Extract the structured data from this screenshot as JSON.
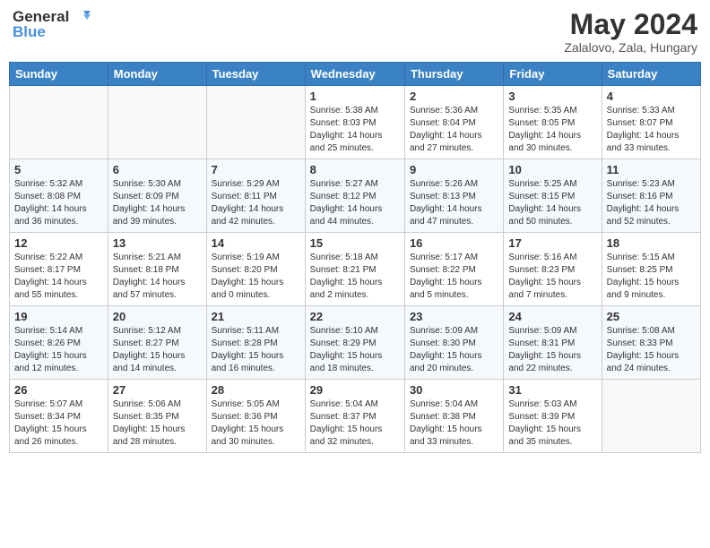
{
  "logo": {
    "text_general": "General",
    "text_blue": "Blue"
  },
  "title": {
    "month_year": "May 2024",
    "location": "Zalalovo, Zala, Hungary"
  },
  "days_of_week": [
    "Sunday",
    "Monday",
    "Tuesday",
    "Wednesday",
    "Thursday",
    "Friday",
    "Saturday"
  ],
  "weeks": [
    [
      {
        "day": "",
        "info": ""
      },
      {
        "day": "",
        "info": ""
      },
      {
        "day": "",
        "info": ""
      },
      {
        "day": "1",
        "info": "Sunrise: 5:38 AM\nSunset: 8:03 PM\nDaylight: 14 hours\nand 25 minutes."
      },
      {
        "day": "2",
        "info": "Sunrise: 5:36 AM\nSunset: 8:04 PM\nDaylight: 14 hours\nand 27 minutes."
      },
      {
        "day": "3",
        "info": "Sunrise: 5:35 AM\nSunset: 8:05 PM\nDaylight: 14 hours\nand 30 minutes."
      },
      {
        "day": "4",
        "info": "Sunrise: 5:33 AM\nSunset: 8:07 PM\nDaylight: 14 hours\nand 33 minutes."
      }
    ],
    [
      {
        "day": "5",
        "info": "Sunrise: 5:32 AM\nSunset: 8:08 PM\nDaylight: 14 hours\nand 36 minutes."
      },
      {
        "day": "6",
        "info": "Sunrise: 5:30 AM\nSunset: 8:09 PM\nDaylight: 14 hours\nand 39 minutes."
      },
      {
        "day": "7",
        "info": "Sunrise: 5:29 AM\nSunset: 8:11 PM\nDaylight: 14 hours\nand 42 minutes."
      },
      {
        "day": "8",
        "info": "Sunrise: 5:27 AM\nSunset: 8:12 PM\nDaylight: 14 hours\nand 44 minutes."
      },
      {
        "day": "9",
        "info": "Sunrise: 5:26 AM\nSunset: 8:13 PM\nDaylight: 14 hours\nand 47 minutes."
      },
      {
        "day": "10",
        "info": "Sunrise: 5:25 AM\nSunset: 8:15 PM\nDaylight: 14 hours\nand 50 minutes."
      },
      {
        "day": "11",
        "info": "Sunrise: 5:23 AM\nSunset: 8:16 PM\nDaylight: 14 hours\nand 52 minutes."
      }
    ],
    [
      {
        "day": "12",
        "info": "Sunrise: 5:22 AM\nSunset: 8:17 PM\nDaylight: 14 hours\nand 55 minutes."
      },
      {
        "day": "13",
        "info": "Sunrise: 5:21 AM\nSunset: 8:18 PM\nDaylight: 14 hours\nand 57 minutes."
      },
      {
        "day": "14",
        "info": "Sunrise: 5:19 AM\nSunset: 8:20 PM\nDaylight: 15 hours\nand 0 minutes."
      },
      {
        "day": "15",
        "info": "Sunrise: 5:18 AM\nSunset: 8:21 PM\nDaylight: 15 hours\nand 2 minutes."
      },
      {
        "day": "16",
        "info": "Sunrise: 5:17 AM\nSunset: 8:22 PM\nDaylight: 15 hours\nand 5 minutes."
      },
      {
        "day": "17",
        "info": "Sunrise: 5:16 AM\nSunset: 8:23 PM\nDaylight: 15 hours\nand 7 minutes."
      },
      {
        "day": "18",
        "info": "Sunrise: 5:15 AM\nSunset: 8:25 PM\nDaylight: 15 hours\nand 9 minutes."
      }
    ],
    [
      {
        "day": "19",
        "info": "Sunrise: 5:14 AM\nSunset: 8:26 PM\nDaylight: 15 hours\nand 12 minutes."
      },
      {
        "day": "20",
        "info": "Sunrise: 5:12 AM\nSunset: 8:27 PM\nDaylight: 15 hours\nand 14 minutes."
      },
      {
        "day": "21",
        "info": "Sunrise: 5:11 AM\nSunset: 8:28 PM\nDaylight: 15 hours\nand 16 minutes."
      },
      {
        "day": "22",
        "info": "Sunrise: 5:10 AM\nSunset: 8:29 PM\nDaylight: 15 hours\nand 18 minutes."
      },
      {
        "day": "23",
        "info": "Sunrise: 5:09 AM\nSunset: 8:30 PM\nDaylight: 15 hours\nand 20 minutes."
      },
      {
        "day": "24",
        "info": "Sunrise: 5:09 AM\nSunset: 8:31 PM\nDaylight: 15 hours\nand 22 minutes."
      },
      {
        "day": "25",
        "info": "Sunrise: 5:08 AM\nSunset: 8:33 PM\nDaylight: 15 hours\nand 24 minutes."
      }
    ],
    [
      {
        "day": "26",
        "info": "Sunrise: 5:07 AM\nSunset: 8:34 PM\nDaylight: 15 hours\nand 26 minutes."
      },
      {
        "day": "27",
        "info": "Sunrise: 5:06 AM\nSunset: 8:35 PM\nDaylight: 15 hours\nand 28 minutes."
      },
      {
        "day": "28",
        "info": "Sunrise: 5:05 AM\nSunset: 8:36 PM\nDaylight: 15 hours\nand 30 minutes."
      },
      {
        "day": "29",
        "info": "Sunrise: 5:04 AM\nSunset: 8:37 PM\nDaylight: 15 hours\nand 32 minutes."
      },
      {
        "day": "30",
        "info": "Sunrise: 5:04 AM\nSunset: 8:38 PM\nDaylight: 15 hours\nand 33 minutes."
      },
      {
        "day": "31",
        "info": "Sunrise: 5:03 AM\nSunset: 8:39 PM\nDaylight: 15 hours\nand 35 minutes."
      },
      {
        "day": "",
        "info": ""
      }
    ]
  ]
}
